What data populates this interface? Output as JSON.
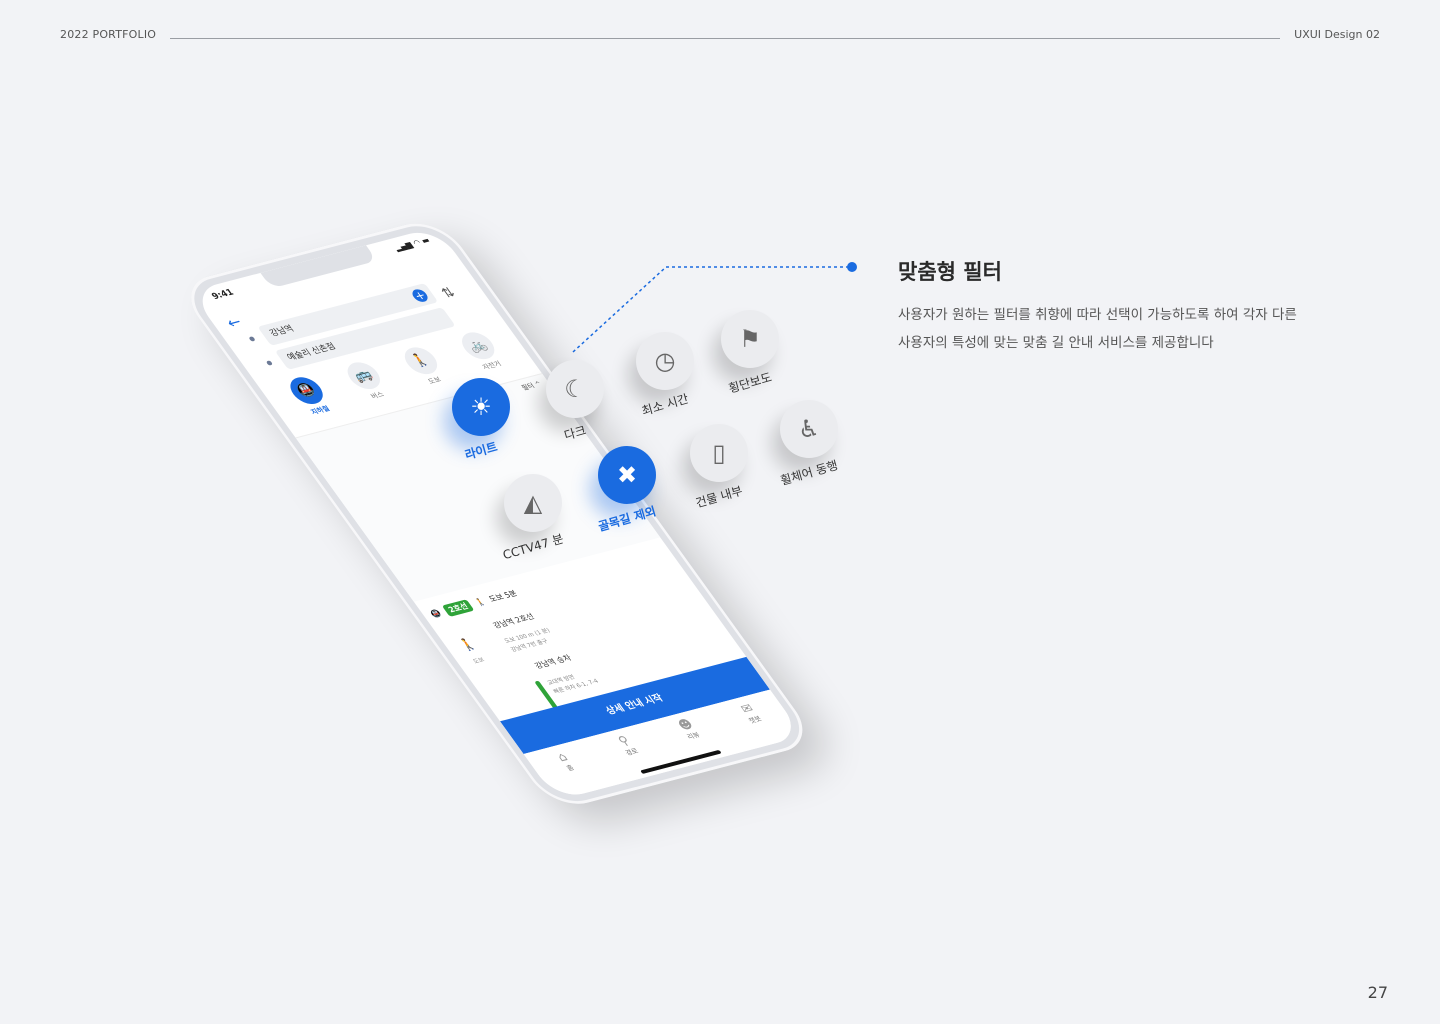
{
  "header": {
    "left": "2022 PORTFOLIO",
    "right": "UXUI Design 02"
  },
  "page_number": "27",
  "description": {
    "title": "맞춤형 필터",
    "line1": "사용자가 원하는 필터를 취향에 따라 선택이 가능하도록 하여 각자 다른",
    "line2": "사용자의 특성에 맞는 맞춤 길 안내 서비스를 제공합니다"
  },
  "phone": {
    "time": "9:41",
    "origin": "강남역",
    "destination": "예술리 신촌점",
    "modes": [
      {
        "label": "지하철",
        "icon": "subway-icon",
        "glyph": "🚇"
      },
      {
        "label": "버스",
        "icon": "bus-icon",
        "glyph": "🚌"
      },
      {
        "label": "도보",
        "icon": "walk-icon",
        "glyph": "🚶"
      },
      {
        "label": "자전거",
        "icon": "bike-icon",
        "glyph": "🚲"
      }
    ],
    "filter_label": "필터 ^",
    "line_badge": "2호선",
    "walk_time": "도보 5분",
    "step1_title": "강남역 2호선",
    "step1_sub1": "도보 100 m (1 분)",
    "step1_sub2": "강남역 7번 출구",
    "walk_label": "도보",
    "step2_title": "강남역 승차",
    "step2_sub1": "교대역 방면",
    "step2_sub2": "빠른 하차 6-1, 7-4",
    "cta": "상세 안내 시작",
    "tabs": [
      {
        "label": "홈",
        "icon": "home-icon",
        "glyph": "⌂"
      },
      {
        "label": "경로",
        "icon": "route-pin-icon",
        "glyph": "⚲"
      },
      {
        "label": "리뷰",
        "icon": "review-icon",
        "glyph": "☻"
      },
      {
        "label": "챗봇",
        "icon": "chatbot-icon",
        "glyph": "✉"
      }
    ]
  },
  "filters": [
    {
      "label": "라이트",
      "icon": "sun-icon",
      "glyph": "☀",
      "active": true
    },
    {
      "label": "다크",
      "icon": "moon-icon",
      "glyph": "☾",
      "active": false
    },
    {
      "label": "최소 시간",
      "icon": "clock-icon",
      "glyph": "◷",
      "active": false
    },
    {
      "label": "횡단보도",
      "icon": "crosswalk-icon",
      "glyph": "⚑",
      "active": false
    },
    {
      "label": "CCTV",
      "icon": "cctv-icon",
      "glyph": "◭",
      "active": false
    },
    {
      "label": "골목길 제외",
      "icon": "alley-exclude-icon",
      "glyph": "✖",
      "active": true
    },
    {
      "label": "건물 내부",
      "icon": "door-icon",
      "glyph": "▯",
      "active": false
    },
    {
      "label": "휠체어 동행",
      "icon": "wheelchair-icon",
      "glyph": "♿",
      "active": false
    }
  ],
  "cctv_count": "47 분",
  "colors": {
    "accent": "#1a6be0",
    "line2": "#2fa339",
    "background": "#f2f3f6"
  }
}
